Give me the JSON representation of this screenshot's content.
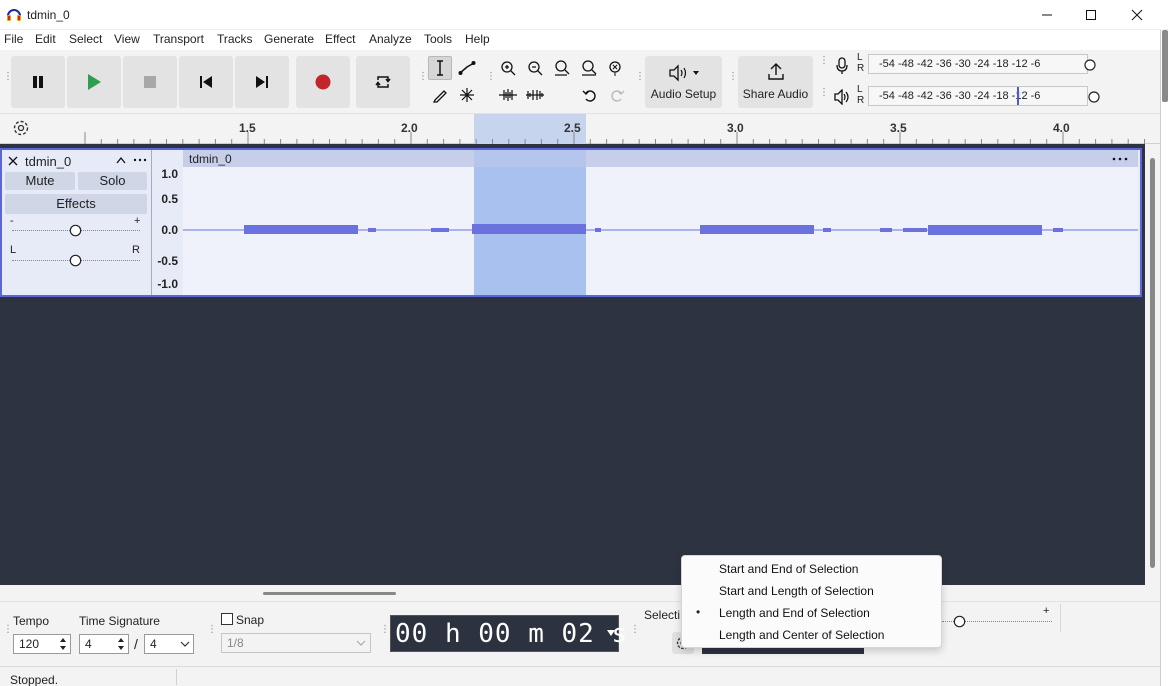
{
  "window": {
    "title": "tdmin_0",
    "minimize": "—",
    "maximize": "☐",
    "close": "✕"
  },
  "menu": [
    "File",
    "Edit",
    "Select",
    "View",
    "Transport",
    "Tracks",
    "Generate",
    "Effect",
    "Analyze",
    "Tools",
    "Help"
  ],
  "toolbar": {
    "audio_setup_label": "Audio Setup",
    "share_audio_label": "Share Audio",
    "meter_scale": "-54 -48 -42 -36 -30 -24 -18 -12 -6",
    "record_meter_lr": "L R",
    "play_meter_lr": "L R",
    "colors": {
      "play": "#2e9e4f",
      "record": "#c0262a",
      "button_bg": "#e3e3e3"
    }
  },
  "ruler": {
    "ticks": [
      "1.5",
      "2.0",
      "2.5",
      "3.0",
      "3.5",
      "4.0"
    ]
  },
  "track": {
    "name": "tdmin_0",
    "clip_name": "tdmin_0",
    "mute": "Mute",
    "solo": "Solo",
    "effects": "Effects",
    "gain_minus": "-",
    "gain_plus": "+",
    "pan_left": "L",
    "pan_right": "R",
    "vruler": [
      "1.0",
      "0.5",
      "0.0",
      "-0.5",
      "-1.0"
    ],
    "colors": {
      "selection": "#a9c1ee",
      "waveform": "#6b72de",
      "border": "#5b67d9"
    }
  },
  "bottom": {
    "tempo_label": "Tempo",
    "tempo_value": "120",
    "time_sig_label": "Time Signature",
    "time_sig_num": "4",
    "time_sig_slash": "/",
    "time_sig_den": "4",
    "snap_label": "Snap",
    "snap_value": "1/8",
    "time_display": "00 h 00 m 02 s",
    "selection_label": "Selecti",
    "speed_plus": "+"
  },
  "context_menu": {
    "items": [
      "Start and End of Selection",
      "Start and Length of Selection",
      "Length and End of Selection",
      "Length and Center of Selection"
    ],
    "selected_bullet": "•"
  },
  "status": {
    "text": "Stopped."
  }
}
